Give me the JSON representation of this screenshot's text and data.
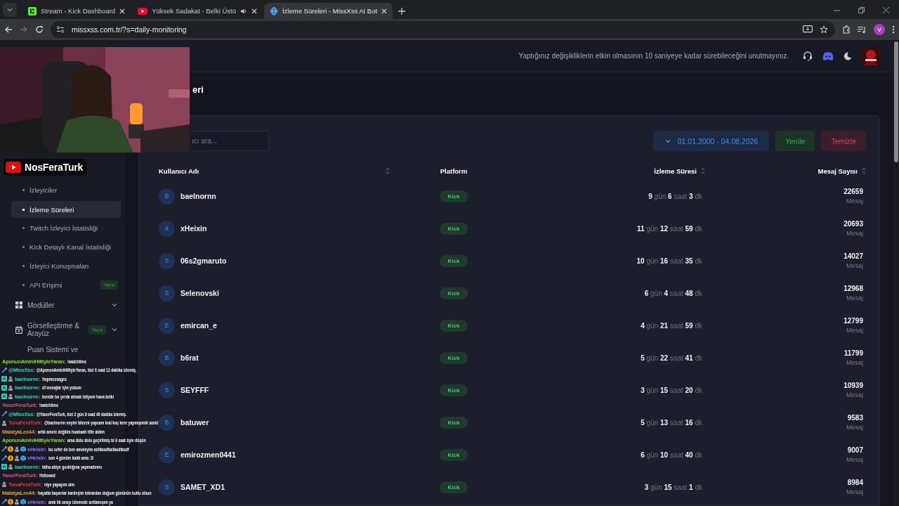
{
  "browser": {
    "tabs": [
      {
        "title": "Stream - Kick Dashboard",
        "kind": "kick",
        "audio": false,
        "selected": false
      },
      {
        "title": "Yüksek Sadakat - Belki Üstü",
        "kind": "youtube",
        "audio": true,
        "selected": false
      },
      {
        "title": "İzleme Süreleri - MissXss AI Bot",
        "kind": "globe",
        "audio": false,
        "selected": true
      }
    ],
    "url": "missxss.com.tr/?s=daily-monitoring",
    "profile": "V"
  },
  "header": {
    "notice": "Yaptığınız değişikliklerin etkin olmasının 10 saniyeye kadar sürebileceğini unutmayınız."
  },
  "sidebar": {
    "items": [
      {
        "label": "İzleyiciler",
        "kind": "sub",
        "selected": false
      },
      {
        "label": "İzleme Süreleri",
        "kind": "sub",
        "selected": true
      },
      {
        "label": "Twitch İzleyici İstatisliği",
        "kind": "sub",
        "selected": false
      },
      {
        "label": "Kick Detaylı Kanal İstatisliği",
        "kind": "sub",
        "selected": false
      },
      {
        "label": "İzleyici Konuşmaları",
        "kind": "sub",
        "selected": false
      },
      {
        "label": "API Erişimi",
        "kind": "sub",
        "badge": "Yeni",
        "selected": false
      },
      {
        "label": "Modüller",
        "kind": "grid",
        "selected": false
      },
      {
        "label": "Görselleştirme & Arayüz",
        "kind": "calendar",
        "badge": "Yeni",
        "selected": false
      },
      {
        "label": "Puan Sistemi ve",
        "kind": "short",
        "selected": false
      }
    ]
  },
  "page": {
    "title": "eri",
    "search": {
      "placeholder": "ıcı ara..."
    },
    "date_range": "01.01.2000 - 04.08.2026",
    "buttons": [
      {
        "label": "Yenile",
        "kind": "refresh"
      },
      {
        "label": "Temizle",
        "kind": "clear"
      }
    ]
  },
  "table": {
    "columns": [
      {
        "label": "Kullanıcı Adı",
        "sortable": true
      },
      {
        "label": "Platform",
        "sortable": false
      },
      {
        "label": "İzleme Süresi",
        "sortable": true
      },
      {
        "label": "Mesaj Sayısı",
        "sortable": true
      }
    ],
    "rows": [
      {
        "initial": "B",
        "user": "baelnornn",
        "platform": "Kick",
        "watch_time": "**9** gün **6** saat **3** dk",
        "messages": "22659",
        "unit": "Mesaj"
      },
      {
        "initial": "X",
        "user": "xHeixin",
        "platform": "Kick",
        "watch_time": "**11** gün **12** saat **59** dk",
        "messages": "20693",
        "unit": "Mesaj"
      },
      {
        "initial": "0",
        "user": "06s2gmaruto",
        "platform": "Kick",
        "watch_time": "**10** gün **16** saat **35** dk",
        "messages": "14027",
        "unit": "Mesaj"
      },
      {
        "initial": "S",
        "user": "Selenovski",
        "platform": "Kick",
        "watch_time": "**6** gün **4** saat **48** dk",
        "messages": "12968",
        "unit": "Mesaj"
      },
      {
        "initial": "E",
        "user": "emircan_e",
        "platform": "Kick",
        "watch_time": "**4** gün **21** saat **59** dk",
        "messages": "12799",
        "unit": "Mesaj"
      },
      {
        "initial": "B",
        "user": "b6rat",
        "platform": "Kick",
        "watch_time": "**5** gün **22** saat **41** dk",
        "messages": "11799",
        "unit": "Mesaj"
      },
      {
        "initial": "S",
        "user": "SEYFFF",
        "platform": "Kick",
        "watch_time": "**3** gün **15** saat **20** dk",
        "messages": "10939",
        "unit": "Mesaj"
      },
      {
        "initial": "B",
        "user": "batuwer",
        "platform": "Kick",
        "watch_time": "**5** gün **13** saat **16** dk",
        "messages": "9583",
        "unit": "Mesaj"
      },
      {
        "initial": "E",
        "user": "emirozmen0441",
        "platform": "Kick",
        "watch_time": "**6** gün **10** saat **40** dk",
        "messages": "9007",
        "unit": "Mesaj"
      },
      {
        "initial": "S",
        "user": "SAMET_XD1",
        "platform": "Kick",
        "watch_time": "**3** gün **15** saat **1** dk",
        "messages": "8984",
        "unit": "Mesaj"
      }
    ]
  },
  "overlay": {
    "channel": "NosFeraTurk",
    "chat": [
      {
        "user": "AponunAminiHiltiyleYaran:",
        "color": "#8fdc2a",
        "kind": "plain",
        "text": "!watchtime"
      },
      {
        "user": "@MissXss:",
        "color": "#2fd0b8",
        "kind": "bot",
        "text": "@AponunAminiHiltiyleYaran, bizi 6 saat 12 dakika izlemiş."
      },
      {
        "user": "baelnornn:",
        "color": "#2fd0b8",
        "kind": "sub",
        "text": "!topmessages"
      },
      {
        "user": "baelnornn:",
        "color": "#2fd0b8",
        "kind": "sub",
        "text": "üf mesajlar için yokum"
      },
      {
        "user": "baelnornn:",
        "color": "#2fd0b8",
        "kind": "sub",
        "text": "benide bu yerde atmak istiyom hava belki"
      },
      {
        "user": "YaserFeraTurk:",
        "color": "#e05080",
        "kind": "plain",
        "text": "!watchtime"
      },
      {
        "user": "@MissXss:",
        "color": "#2fd0b8",
        "kind": "bot",
        "text": "@YaserFeraTurk, bizi 2 gün 8 saat 40 dakika izlemiş."
      },
      {
        "user": "TunaFeraTurk:",
        "color": "#e03a3a",
        "kind": "viewer",
        "text": "@baelnornn neyini bilerek yapcam kral kaç kere yapmışımki sanki"
      },
      {
        "user": "MalatyaLee44:",
        "color": "#e0a02a",
        "kind": "plain",
        "text": "artık amele değilim huahaah title aldım"
      },
      {
        "user": "AponunAminiHiltiyleYaran:",
        "color": "#8fdc2a",
        "kind": "plain",
        "text": "ama dolu dolu geçirilmiş bi 6 saat öyle düşün"
      },
      {
        "user": "xHeixin:",
        "color": "#9a6cff",
        "kind": "vip",
        "text": "bu sefer de ben ameleyim asfdasdfasfasdfasdf"
      },
      {
        "user": "xHeixin:",
        "color": "#9a6cff",
        "kind": "vip",
        "text": "son 4 günüm kaldı ama :D"
      },
      {
        "user": "baelnornn:",
        "color": "#2fd0b8",
        "kind": "sub",
        "text": "talha abiye gıcıklığına yapmadınmı"
      },
      {
        "user": "YaserFeraTurk:",
        "color": "#e05080",
        "kind": "plain",
        "text": "!followed"
      },
      {
        "user": "TunaFeraTurk:",
        "color": "#e03a3a",
        "kind": "viewer",
        "text": "niye yapayım olm"
      },
      {
        "user": "MalatyaLee44:",
        "color": "#e0a02a",
        "kind": "plain",
        "text": "hayatta başarılar kardeşim tekrardan doğum gününün kutlu olsun"
      },
      {
        "user": "xHeixin:",
        "color": "#9a6cff",
        "kind": "vip",
        "text": "amk ilk sırayı izlemede sırtlamışım ya"
      }
    ]
  }
}
